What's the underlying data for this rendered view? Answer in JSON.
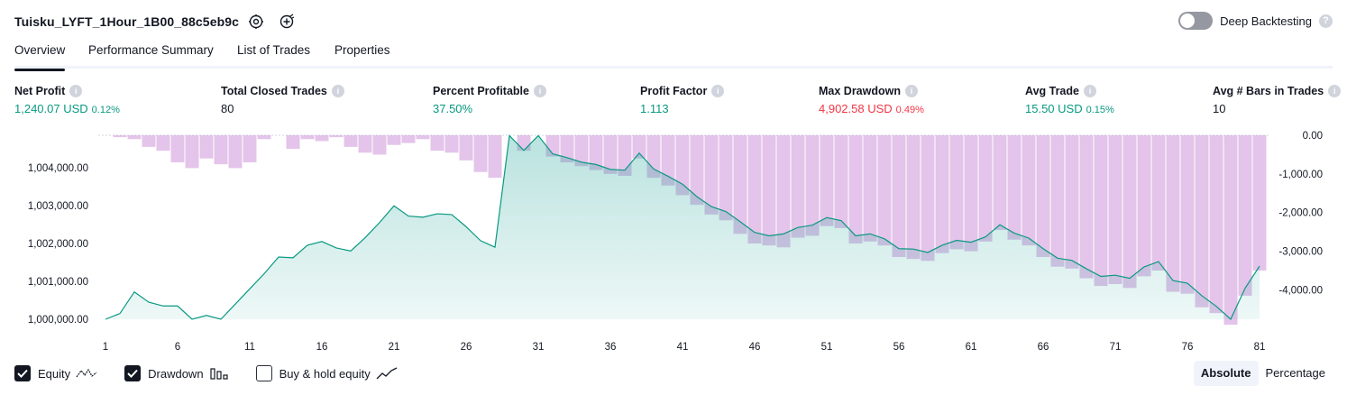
{
  "header": {
    "strategy_name": "Tuisku_LYFT_1Hour_1B00_88c5eb9c",
    "deep_backtesting_label": "Deep Backtesting",
    "deep_backtesting_enabled": false,
    "help_glyph": "?"
  },
  "tabs": [
    {
      "label": "Overview",
      "active": true
    },
    {
      "label": "Performance Summary",
      "active": false
    },
    {
      "label": "List of Trades",
      "active": false
    },
    {
      "label": "Properties",
      "active": false
    }
  ],
  "metrics": [
    {
      "label": "Net Profit",
      "value": "1,240.07 USD",
      "pct": "0.12%",
      "tone": "pos"
    },
    {
      "label": "Total Closed Trades",
      "value": "80",
      "pct": "",
      "tone": "neutral"
    },
    {
      "label": "Percent Profitable",
      "value": "37.50%",
      "pct": "",
      "tone": "pos"
    },
    {
      "label": "Profit Factor",
      "value": "1.113",
      "pct": "",
      "tone": "pos"
    },
    {
      "label": "Max Drawdown",
      "value": "4,902.58 USD",
      "pct": "0.49%",
      "tone": "neg"
    },
    {
      "label": "Avg Trade",
      "value": "15.50 USD",
      "pct": "0.15%",
      "tone": "pos"
    },
    {
      "label": "Avg # Bars in Trades",
      "value": "10",
      "pct": "",
      "tone": "neutral"
    }
  ],
  "info_glyph": "i",
  "chart_data": {
    "type": "area",
    "x": [
      1,
      2,
      3,
      4,
      5,
      6,
      7,
      8,
      9,
      10,
      11,
      12,
      13,
      14,
      15,
      16,
      17,
      18,
      19,
      20,
      21,
      22,
      23,
      24,
      25,
      26,
      27,
      28,
      29,
      30,
      31,
      32,
      33,
      34,
      35,
      36,
      37,
      38,
      39,
      40,
      41,
      42,
      43,
      44,
      45,
      46,
      47,
      48,
      49,
      50,
      51,
      52,
      53,
      54,
      55,
      56,
      57,
      58,
      59,
      60,
      61,
      62,
      63,
      64,
      65,
      66,
      67,
      68,
      69,
      70,
      71,
      72,
      73,
      74,
      75,
      76,
      77,
      78,
      79,
      80,
      81
    ],
    "x_ticks": [
      1,
      6,
      11,
      16,
      21,
      26,
      31,
      36,
      41,
      46,
      51,
      56,
      61,
      66,
      71,
      76,
      81
    ],
    "series": [
      {
        "axis": "left",
        "color": "#089981",
        "values": [
          1000000,
          1000150,
          1000720,
          1000450,
          1000350,
          1000350,
          1000000,
          1000100,
          1000000,
          1000400,
          1000800,
          1001200,
          1001640,
          1001620,
          1001950,
          1002050,
          1001880,
          1001800,
          1002150,
          1002550,
          1002990,
          1002720,
          1002690,
          1002780,
          1002760,
          1002440,
          1002070,
          1001900,
          1004840,
          1004450,
          1004840,
          1004360,
          1004260,
          1004140,
          1004080,
          1003950,
          1003930,
          1004380,
          1003960,
          1003770,
          1003560,
          1003230,
          1002970,
          1002840,
          1002570,
          1002290,
          1002200,
          1002250,
          1002420,
          1002480,
          1002680,
          1002600,
          1002200,
          1002250,
          1002120,
          1001860,
          1001850,
          1001760,
          1001950,
          1002080,
          1002030,
          1002170,
          1002490,
          1002270,
          1002140,
          1001860,
          1001610,
          1001550,
          1001330,
          1001130,
          1001160,
          1001080,
          1001380,
          1001520,
          1001020,
          1000950,
          1000620,
          1000340,
          1000000,
          1000820,
          1001400
        ]
      },
      {
        "axis": "right",
        "color": "#ce93d8",
        "values": [
          0,
          -50,
          -100,
          -300,
          -400,
          -700,
          -850,
          -600,
          -750,
          -850,
          -700,
          -100,
          0,
          -350,
          -100,
          -150,
          -50,
          -300,
          -450,
          -500,
          -250,
          -200,
          -100,
          -400,
          -450,
          -650,
          -950,
          -1100,
          0,
          -400,
          0,
          -550,
          -700,
          -800,
          -900,
          -1000,
          -1050,
          -600,
          -1100,
          -1300,
          -1550,
          -1800,
          -2050,
          -2200,
          -2550,
          -2800,
          -2850,
          -2900,
          -2650,
          -2600,
          -2350,
          -2400,
          -2800,
          -2750,
          -2850,
          -3150,
          -3200,
          -3250,
          -3050,
          -2950,
          -3000,
          -2750,
          -2450,
          -2700,
          -2850,
          -3150,
          -3400,
          -3450,
          -3700,
          -3900,
          -3850,
          -3950,
          -3650,
          -3500,
          -4050,
          -4100,
          -4450,
          -4600,
          -4900,
          -4150,
          -3500
        ]
      }
    ],
    "left_axis": {
      "ticks": [
        1000000,
        1001000,
        1002000,
        1003000,
        1004000
      ],
      "tick_labels": [
        "1,000,000.00",
        "1,001,000.00",
        "1,002,000.00",
        "1,003,000.00",
        "1,004,000.00"
      ],
      "ylim": [
        1000000,
        1004850
      ]
    },
    "right_axis": {
      "ticks": [
        0,
        -1000,
        -2000,
        -3000,
        -4000
      ],
      "tick_labels": [
        "0.00",
        "-1,000.00",
        "-2,000.00",
        "-3,000.00",
        "-4,000.00"
      ],
      "ylim": [
        -4900,
        0
      ]
    },
    "grid": false
  },
  "legend": {
    "items": [
      {
        "label": "Equity",
        "checked": true,
        "icon": "equity-line-icon"
      },
      {
        "label": "Drawdown",
        "checked": true,
        "icon": "drawdown-bars-icon"
      },
      {
        "label": "Buy & hold equity",
        "checked": false,
        "icon": "buy-hold-line-icon"
      }
    ]
  },
  "view_toggle": {
    "absolute": "Absolute",
    "percentage": "Percentage",
    "selected": "Absolute"
  }
}
